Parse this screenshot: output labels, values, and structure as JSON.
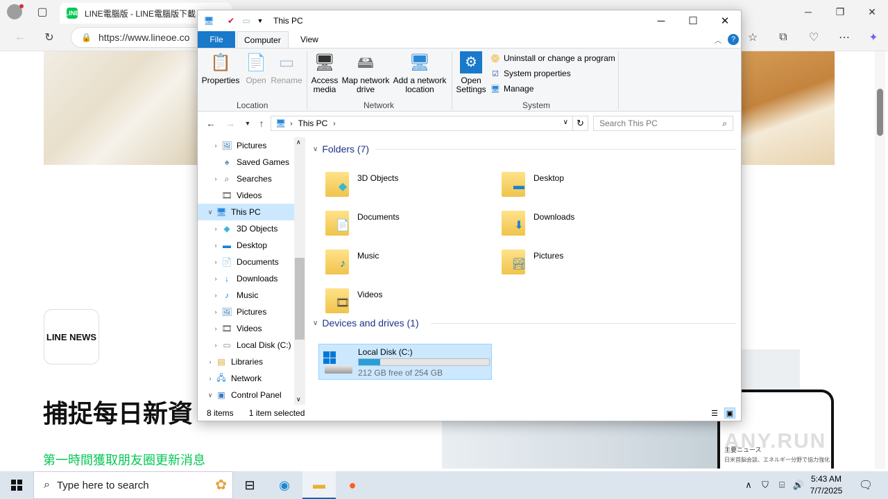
{
  "browser": {
    "tab_title": "LINE電腦版 - LINE電腦版下載",
    "tab_favicon": "LINE",
    "url": "https://www.lineoe.co",
    "accent": "#06c755"
  },
  "webpage": {
    "logo": "LINE NEWS",
    "headline": "捕捉每日新資",
    "subline": "第一時間獲取朋友圈更新消息",
    "phone_title": "ース",
    "phone_line1": "主要ニュース",
    "phone_line2": "日米首脳会談、エネルギー分野で協力強化",
    "watermark": "ANY.RUN"
  },
  "explorer": {
    "title": "This PC",
    "tabs": {
      "file": "File",
      "computer": "Computer",
      "view": "View"
    },
    "ribbon": {
      "location": {
        "label": "Location",
        "properties": "Properties",
        "open": "Open",
        "rename": "Rename"
      },
      "network": {
        "label": "Network",
        "access_media_1": "Access",
        "access_media_2": "media",
        "map_drive_1": "Map network",
        "map_drive_2": "drive",
        "add_location_1": "Add a network",
        "add_location_2": "location"
      },
      "system": {
        "label": "System",
        "open_settings_1": "Open",
        "open_settings_2": "Settings",
        "uninstall": "Uninstall or change a program",
        "system_properties": "System properties",
        "manage": "Manage"
      }
    },
    "address": {
      "crumb": "This PC"
    },
    "search_placeholder": "Search This PC",
    "nav_tree": [
      {
        "label": "Pictures",
        "icon": "pictures-icon",
        "expandable": true
      },
      {
        "label": "Saved Games",
        "icon": "saved-games-icon",
        "expandable": false
      },
      {
        "label": "Searches",
        "icon": "searches-icon",
        "expandable": true
      },
      {
        "label": "Videos",
        "icon": "videos-icon",
        "expandable": false
      },
      {
        "label": "This PC",
        "icon": "this-pc-icon",
        "expanded": true,
        "selected": true
      },
      {
        "label": "3D Objects",
        "icon": "3d-objects-icon",
        "expandable": true
      },
      {
        "label": "Desktop",
        "icon": "desktop-icon",
        "expandable": true
      },
      {
        "label": "Documents",
        "icon": "documents-icon",
        "expandable": true
      },
      {
        "label": "Downloads",
        "icon": "downloads-icon",
        "expandable": true
      },
      {
        "label": "Music",
        "icon": "music-icon",
        "expandable": true
      },
      {
        "label": "Pictures",
        "icon": "pictures-icon",
        "expandable": true
      },
      {
        "label": "Videos",
        "icon": "videos-icon",
        "expandable": true
      },
      {
        "label": "Local Disk (C:)",
        "icon": "local-disk-icon",
        "expandable": true
      },
      {
        "label": "Libraries",
        "icon": "libraries-icon",
        "expandable": true
      },
      {
        "label": "Network",
        "icon": "network-icon",
        "expandable": true
      },
      {
        "label": "Control Panel",
        "icon": "control-panel-icon",
        "expanded": true
      }
    ],
    "folders_header": "Folders (7)",
    "folders": [
      {
        "name": "3D Objects",
        "icon": "3d-objects-icon"
      },
      {
        "name": "Desktop",
        "icon": "desktop-icon"
      },
      {
        "name": "Documents",
        "icon": "documents-icon"
      },
      {
        "name": "Downloads",
        "icon": "downloads-icon"
      },
      {
        "name": "Music",
        "icon": "music-icon"
      },
      {
        "name": "Pictures",
        "icon": "pictures-icon"
      },
      {
        "name": "Videos",
        "icon": "videos-icon"
      }
    ],
    "devices_header": "Devices and drives (1)",
    "drive": {
      "name": "Local Disk (C:)",
      "free_text": "212 GB free of 254 GB",
      "used_fraction": 0.165
    },
    "status": {
      "items": "8 items",
      "selected": "1 item selected"
    }
  },
  "taskbar": {
    "search_placeholder": "Type here to search",
    "time": "5:43 AM",
    "date": "7/7/2025"
  }
}
